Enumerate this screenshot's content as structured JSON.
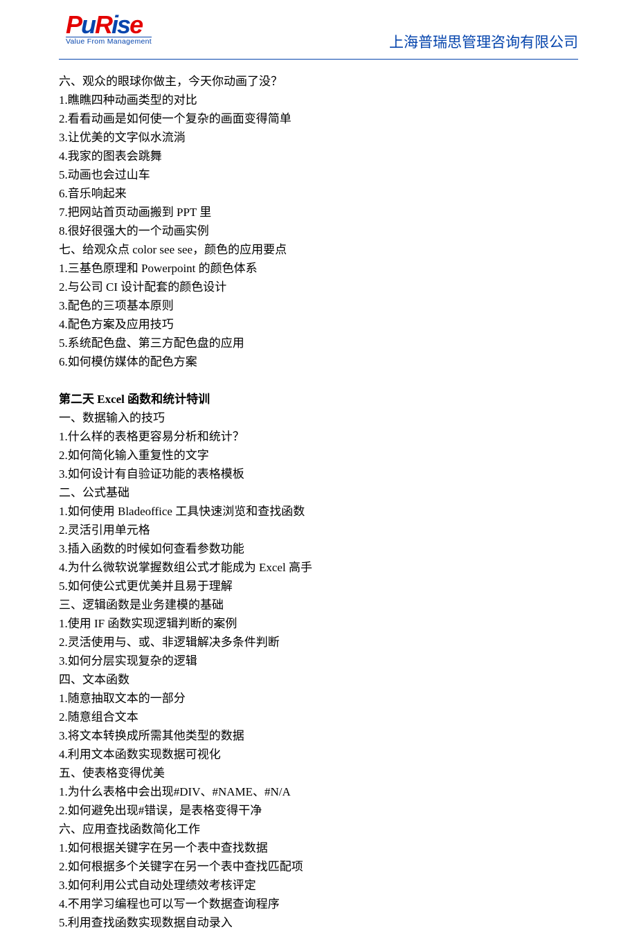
{
  "logo": {
    "letters": [
      "P",
      "u",
      "R",
      "i",
      "s",
      "e"
    ],
    "subtitle": "Value From Management"
  },
  "company": "上海普瑞思管理咨询有限公司",
  "sections": [
    {
      "heading": "六、观众的眼球你做主，今天你动画了没？",
      "items": [
        "1.瞧瞧四种动画类型的对比",
        "2.看看动画是如何使一个复杂的画面变得简单",
        "3.让优美的文字似水流淌",
        "4.我家的图表会跳舞",
        "5.动画也会过山车",
        "6.音乐响起来",
        "7.把网站首页动画搬到 PPT 里",
        "8.很好很强大的一个动画实例"
      ]
    },
    {
      "heading": "七、给观众点 color see see，颜色的应用要点",
      "items": [
        "1.三基色原理和 Powerpoint 的颜色体系",
        "2.与公司 CI 设计配套的颜色设计",
        "3.配色的三项基本原则",
        "4.配色方案及应用技巧",
        "5.系统配色盘、第三方配色盘的应用",
        "6.如何模仿媒体的配色方案"
      ]
    }
  ],
  "day2": {
    "title": "第二天 Excel 函数和统计特训",
    "sections": [
      {
        "heading": "一、数据输入的技巧",
        "items": [
          "1.什么样的表格更容易分析和统计？",
          "2.如何简化输入重复性的文字",
          "3.如何设计有自验证功能的表格模板"
        ]
      },
      {
        "heading": "二、公式基础",
        "items": [
          "1.如何使用 Bladeoffice 工具快速浏览和查找函数",
          "2.灵活引用单元格",
          "3.插入函数的时候如何查看参数功能",
          "4.为什么微软说掌握数组公式才能成为 Excel 高手",
          "5.如何使公式更优美并且易于理解"
        ]
      },
      {
        "heading": "三、逻辑函数是业务建模的基础",
        "items": [
          "1.使用 IF 函数实现逻辑判断的案例",
          "2.灵活使用与、或、非逻辑解决多条件判断",
          "3.如何分层实现复杂的逻辑"
        ]
      },
      {
        "heading": "四、文本函数",
        "items": [
          "1.随意抽取文本的一部分",
          "2.随意组合文本",
          "3.将文本转换成所需其他类型的数据",
          "4.利用文本函数实现数据可视化"
        ]
      },
      {
        "heading": "五、使表格变得优美",
        "items": [
          "1.为什么表格中会出现#DIV、#NAME、#N/A",
          "2.如何避免出现#错误，是表格变得干净"
        ]
      },
      {
        "heading": "六、应用查找函数简化工作",
        "items": [
          "1.如何根据关键字在另一个表中查找数据",
          "2.如何根据多个关键字在另一个表中查找匹配项",
          "3.如何利用公式自动处理绩效考核评定",
          "4.不用学习编程也可以写一个数据查询程序",
          "5.利用查找函数实现数据自动录入"
        ]
      }
    ]
  }
}
